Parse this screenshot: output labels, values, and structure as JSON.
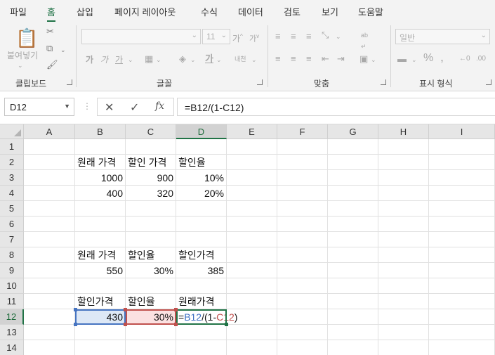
{
  "menu": {
    "tabs": [
      "파일",
      "홈",
      "삽입",
      "페이지 레이아웃",
      "수식",
      "데이터",
      "검토",
      "보기",
      "도움말"
    ],
    "active": "홈"
  },
  "ribbon": {
    "clipboard_label": "클립보드",
    "paste_label": "붙여넣기",
    "font_label": "글꼴",
    "font_size": "11",
    "align_label": "맞춤",
    "number_label": "표시 형식",
    "number_format": "일반"
  },
  "formula_bar": {
    "name_box": "D12",
    "formula": "=B12/(1-C12)"
  },
  "grid": {
    "columns": [
      "A",
      "B",
      "C",
      "D",
      "E",
      "F",
      "G",
      "H",
      "I"
    ],
    "rows": [
      "1",
      "2",
      "3",
      "4",
      "5",
      "6",
      "7",
      "8",
      "9",
      "10",
      "11",
      "12",
      "13",
      "14"
    ],
    "selected_column": "D",
    "selected_row": "12",
    "cells": {
      "B2": "원래 가격",
      "C2": "할인 가격",
      "D2": "할인율",
      "B3": "1000",
      "C3": "900",
      "D3": "10%",
      "B4": "400",
      "C4": "320",
      "D4": "20%",
      "B8": "원래 가격",
      "C8": "할인율",
      "D8": "할인가격",
      "B9": "550",
      "C9": "30%",
      "D9": "385",
      "B11": "할인가격",
      "C11": "할인율",
      "D11": "원래가격",
      "B12": "430",
      "C12": "30%"
    },
    "edit_cell": {
      "prefix": "=",
      "ref1": "B12",
      "mid": "/(1-",
      "ref2": "C12",
      "suffix": ")"
    }
  },
  "colors": {
    "accent": "#217346",
    "ref_blue": "#4674c1",
    "ref_red": "#c0504d"
  }
}
